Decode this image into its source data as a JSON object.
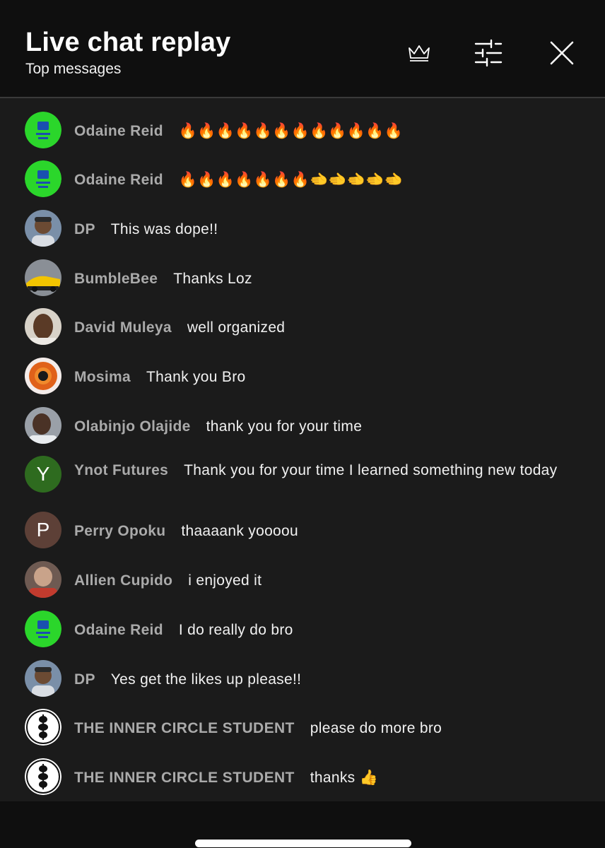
{
  "header": {
    "title": "Live chat replay",
    "subtitle": "Top messages",
    "icons": [
      "crown-icon",
      "tune-icon",
      "close-icon"
    ]
  },
  "messages": [
    {
      "author": "Odaine Reid",
      "text": "🔥🔥🔥🔥🔥🔥🔥🔥🔥🔥🔥🔥",
      "avatar": "green-logo"
    },
    {
      "author": "Odaine Reid",
      "text": "🔥🔥🔥🔥🔥🔥🔥🫲🫲🫲🫲🫲",
      "avatar": "green-logo"
    },
    {
      "author": "DP",
      "text": "This was dope!!",
      "avatar": "photo-person"
    },
    {
      "author": "BumbleBee",
      "text": "Thanks Loz",
      "avatar": "photo-yellow-car"
    },
    {
      "author": "David Muleya",
      "text": "well organized",
      "avatar": "photo-face"
    },
    {
      "author": "Mosima",
      "text": "Thank you Bro",
      "avatar": "photo-eye"
    },
    {
      "author": "Olabinjo Olajide",
      "text": "thank you for your time",
      "avatar": "photo-child"
    },
    {
      "author": "Ynot Futures",
      "text": "Thank you for your time I learned something new today",
      "avatar": "letter",
      "letter": "Y",
      "color": "#2e6b1f"
    },
    {
      "author": "Perry Opoku",
      "text": "thaaaank yoooou",
      "avatar": "letter",
      "letter": "P",
      "color": "#5d4037"
    },
    {
      "author": "Allien Cupido",
      "text": "i enjoyed it",
      "avatar": "photo-person-2"
    },
    {
      "author": "Odaine Reid",
      "text": "I do really do bro",
      "avatar": "green-logo"
    },
    {
      "author": "DP",
      "text": "Yes get the likes up please!!",
      "avatar": "photo-person"
    },
    {
      "author": "THE INNER CIRCLE STUDENT",
      "text": "please do more bro",
      "avatar": "bw-emblem"
    },
    {
      "author": "THE INNER CIRCLE STUDENT",
      "text": "thanks 👍",
      "avatar": "bw-emblem"
    }
  ],
  "colors": {
    "header_bg": "#0f0f0f",
    "chat_bg": "#1b1b1b",
    "author": "#aaaaaa",
    "text": "#f1f1f1"
  }
}
